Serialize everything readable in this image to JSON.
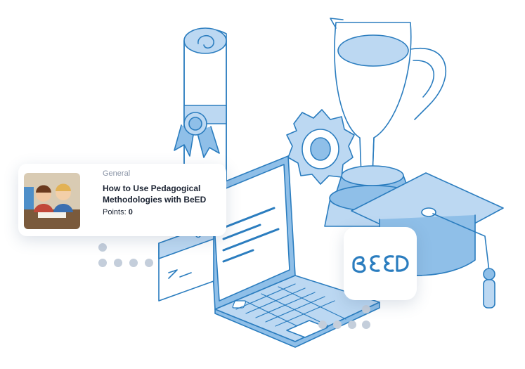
{
  "course_card": {
    "category": "General",
    "title": "How to Use Pedagogical Methodologies with BeED",
    "points_label": "Points:",
    "points_value": "0"
  },
  "brand": {
    "logo_text": "BEED",
    "logo_color": "#2b7dbf"
  },
  "colors": {
    "stroke": "#2b7dbf",
    "fill_light": "#bcd8f2",
    "fill_mid": "#8fbfe8",
    "dot": "#c4cedb"
  }
}
